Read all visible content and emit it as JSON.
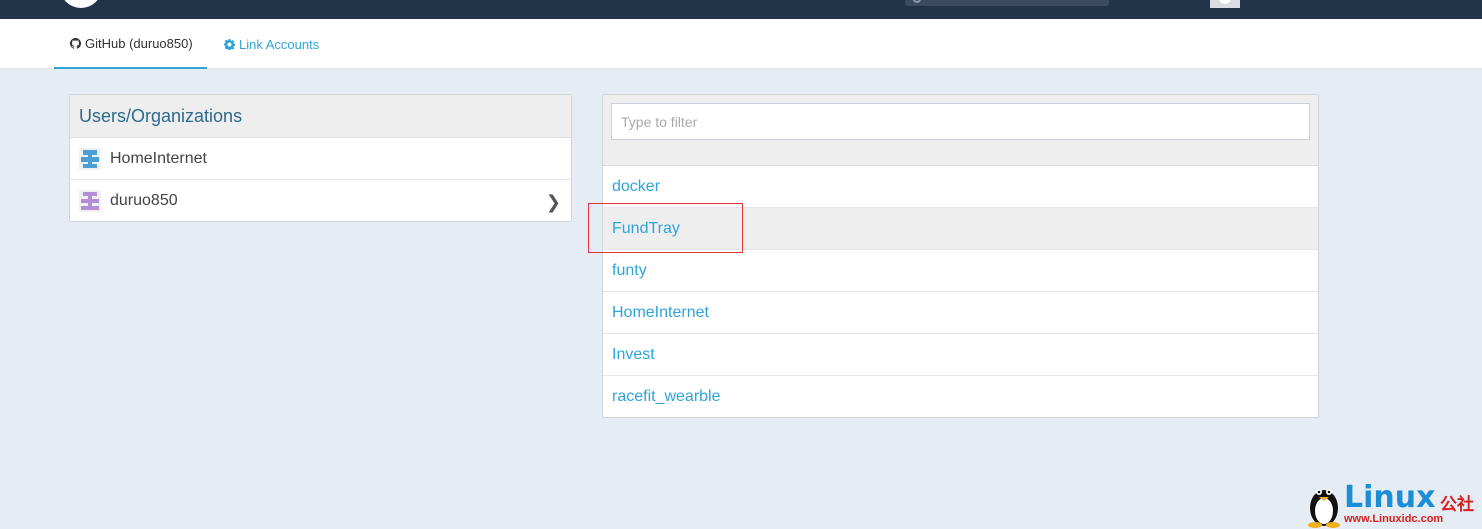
{
  "tabs": {
    "github_label": "GitHub (duruo850)",
    "link_label": "Link Accounts"
  },
  "orgs_panel": {
    "title": "Users/Organizations",
    "items": [
      {
        "name": "HomeInternet",
        "avatar_color": "#4a9fd6"
      },
      {
        "name": "duruo850",
        "avatar_color": "#b48fd8"
      }
    ]
  },
  "repos_panel": {
    "filter_placeholder": "Type to filter",
    "filter_value": "",
    "repos": [
      "docker",
      "FundTray",
      "funty",
      "HomeInternet",
      "Invest",
      "racefit_wearble"
    ],
    "selected": "FundTray"
  },
  "watermark": {
    "brand": "Linux",
    "brand_cn": "公社",
    "url": "www.Linuxidc.com"
  },
  "colors": {
    "navbar": "#22344a",
    "accent": "#2fa4d9",
    "highlight": "#e0353b"
  }
}
